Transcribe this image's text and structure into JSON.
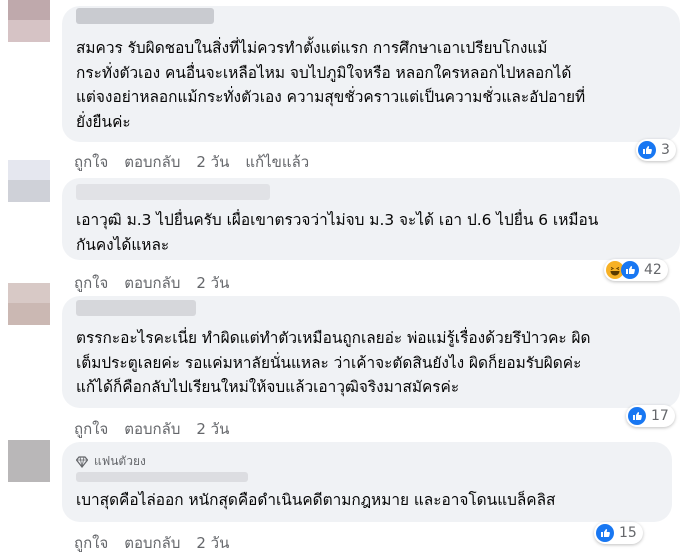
{
  "comments": [
    {
      "text": "สมควร รับผิดชอบในสิ่งที่ไม่ควรทำตั้งแต่แรก การศึกษาเอาเปรียบโกงแม้\nกระทั่งตัวเอง คนอื่นจะเหลือไหม จบไปภูมิใจหรือ หลอกใครหลอกไปหลอกได้\nแต่จงอย่าหลอกแม้กระทั่งตัวเอง ความสุขชั่วคราวแต่เป็นความชั่วและอัปอายที่\nยั่งยืนค่ะ",
      "actions": {
        "like": "ถูกใจ",
        "reply": "ตอบกลับ",
        "time": "2 วัน",
        "edited": "แก้ไขแล้ว"
      },
      "reaction_count": "3",
      "reactions": [
        "like-icon"
      ]
    },
    {
      "text": "เอาวุฒิ ม.3 ไปยื่นครับ เผื่อเขาตรวจว่าไม่จบ ม.3 จะได้ เอา ป.6 ไปยื่น 6 เหมือน\nกันคงได้แหละ",
      "actions": {
        "like": "ถูกใจ",
        "reply": "ตอบกลับ",
        "time": "2 วัน"
      },
      "reaction_count": "42",
      "reactions": [
        "haha-icon",
        "like-icon"
      ]
    },
    {
      "text": "ตรรกะอะไรคะเนี่ย ทำผิดแต่ทำตัวเหมือนถูกเลยอ่ะ พ่อแม่รู้เรื่องด้วยรึป่าวคะ ผิด\nเต็มประตูเลยค่ะ รอแค่มหาลัยนั่นแหละ ว่าเค้าจะตัดสินยังไง ผิดก็ยอมรับผิดค่ะ\nแก้ได้ก็คือกลับไปเรียนใหม่ให้จบแล้วเอาวุฒิจริงมาสมัครค่ะ",
      "actions": {
        "like": "ถูกใจ",
        "reply": "ตอบกลับ",
        "time": "2 วัน"
      },
      "reaction_count": "17",
      "reactions": [
        "like-icon"
      ]
    },
    {
      "badge": "แฟนตัวยง",
      "text": "เบาสุดคือไล่ออก หนักสุดคือดำเนินคดีตามกฎหมาย และอาจโดนแบล็คลิส",
      "actions": {
        "like": "ถูกใจ",
        "reply": "ตอบกลับ",
        "time": "2 วัน"
      },
      "reaction_count": "15",
      "reactions": [
        "like-icon"
      ]
    }
  ],
  "colors": {
    "bubble": "#f0f2f5",
    "secondary_text": "#65676b",
    "like_blue": "#1877f2",
    "haha_yellow": "#f7b125"
  }
}
